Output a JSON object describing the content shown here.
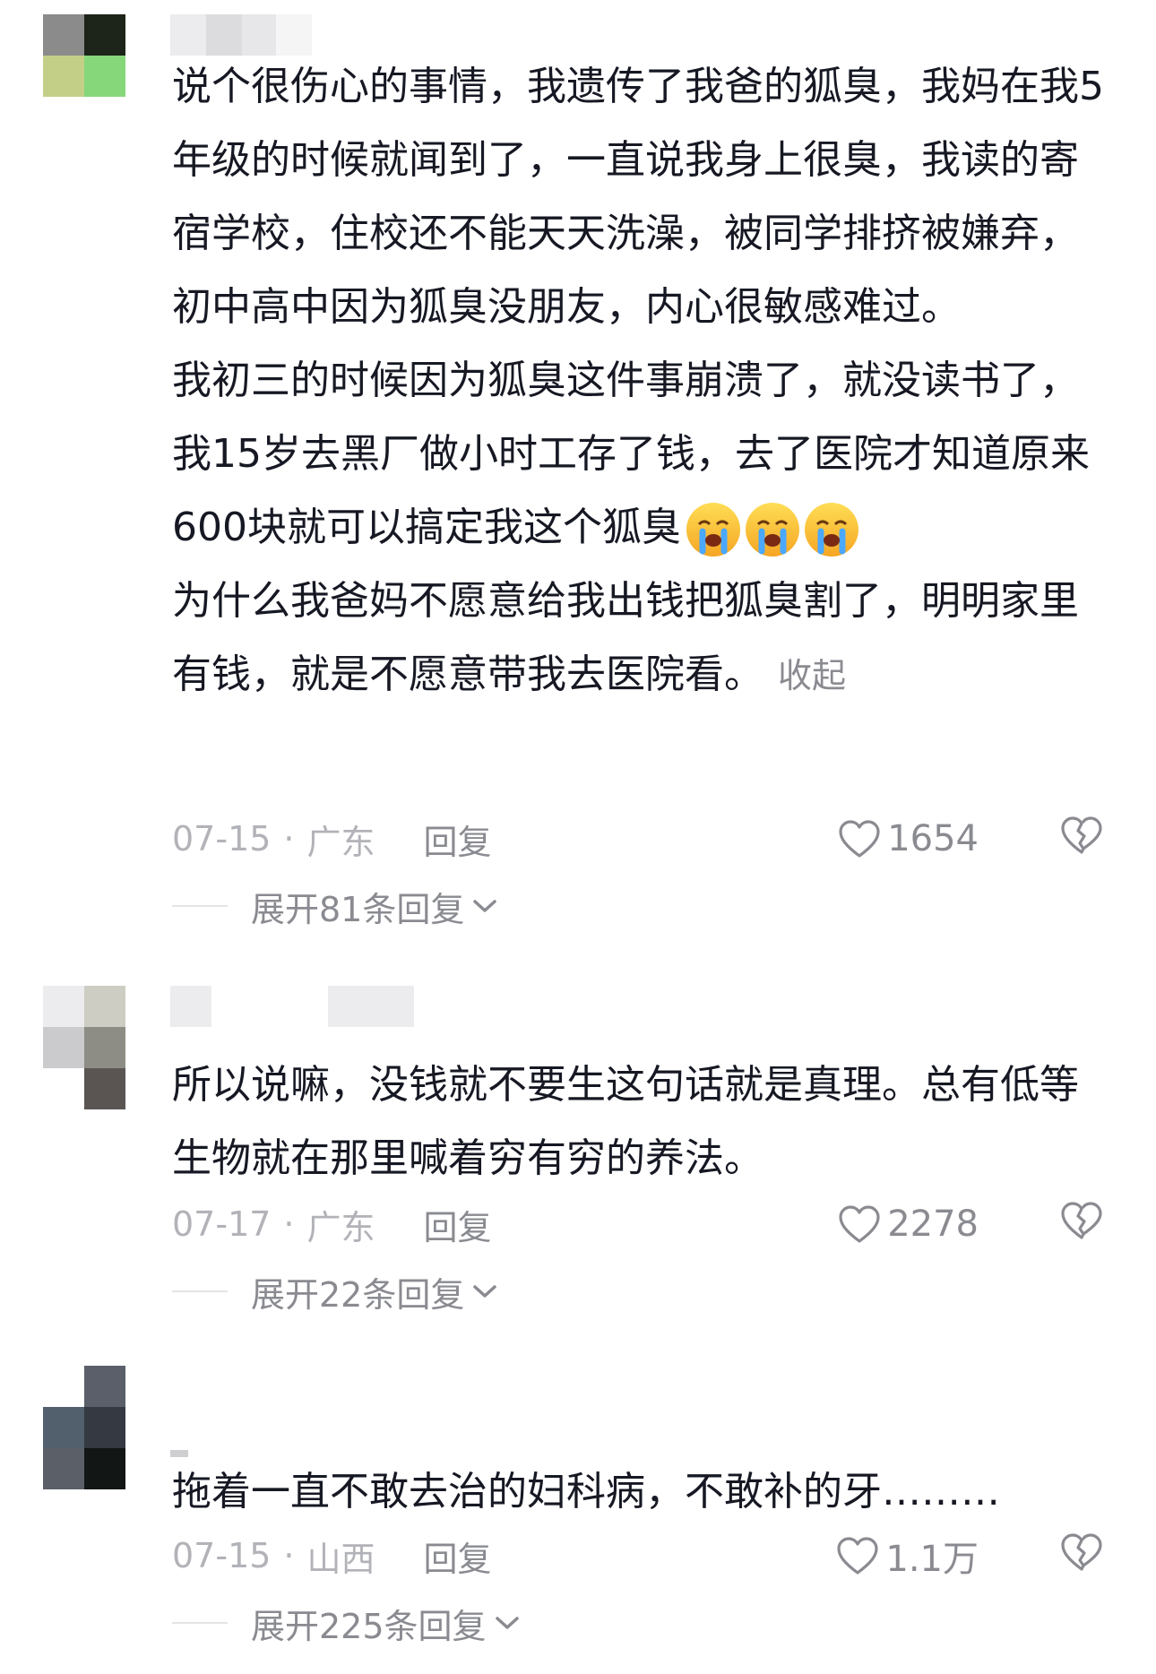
{
  "comments": [
    {
      "paragraphs": [
        "说个很伤心的事情，我遗传了我爸的狐臭，我妈在我5年级的时候就闻到了，一直说我身上很臭，我读的寄宿学校，住校还不能天天洗澡，被同学排挤被嫌弃，初中高中因为狐臭没朋友，内心很敏感难过。",
        "我初三的时候因为狐臭这件事崩溃了，就没读书了，我15岁去黑厂做小时工存了钱，去了医院才知道原来600块就可以搞定我这个狐臭",
        "为什么我爸妈不愿意给我出钱把狐臭割了，明明家里有钱，就是不愿意带我去医院看。"
      ],
      "emoji": "crying-face-icon",
      "collapse_label": "收起",
      "date": "07-15",
      "location": "广东",
      "reply_label": "回复",
      "likes": "1654",
      "expand_label": "展开81条回复"
    },
    {
      "paragraphs": [
        "所以说嘛，没钱就不要生这句话就是真理。总有低等生物就在那里喊着穷有穷的养法。"
      ],
      "date": "07-17",
      "location": "广东",
      "reply_label": "回复",
      "likes": "2278",
      "expand_label": "展开22条回复"
    },
    {
      "paragraphs": [
        "拖着一直不敢去治的妇科病，不敢补的牙………"
      ],
      "date": "07-15",
      "location": "山西",
      "reply_label": "回复",
      "likes": "1.1万",
      "expand_label": "展开225条回复"
    }
  ],
  "colors": {
    "text": "#161823",
    "meta": "#a8a9ae",
    "action": "#8a8b91",
    "divider": "#e4e4e6"
  }
}
